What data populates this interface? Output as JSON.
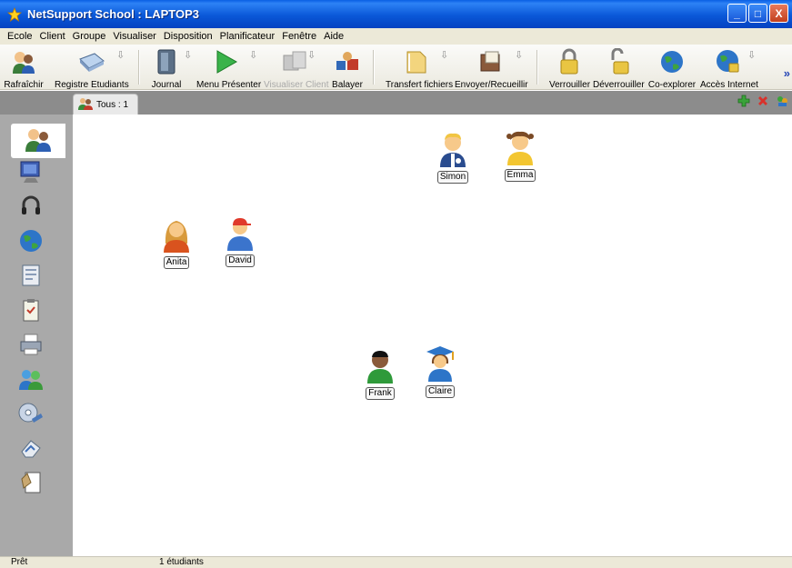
{
  "window": {
    "title": "NetSupport School : LAPTOP3",
    "min_label": "_",
    "max_label": "□",
    "close_label": "X"
  },
  "menu": [
    "Ecole",
    "Client",
    "Groupe",
    "Visualiser",
    "Disposition",
    "Planificateur",
    "Fenêtre",
    "Aide"
  ],
  "toolbar": {
    "refresh": "Rafraîchir",
    "register": "Registre Etudiants",
    "journal": "Journal",
    "present": "Menu Présenter",
    "view": "Visualiser Client",
    "scan": "Balayer",
    "transfer": "Transfert fichiers",
    "collect": "Envoyer/Recueillir",
    "lock": "Verrouiller",
    "unlock": "Déverrouiller",
    "coexplore": "Co-explorer",
    "internet": "Accès Internet",
    "more": "»",
    "drop_arrow": "⇩"
  },
  "tab": {
    "label": "Tous : 1"
  },
  "students": [
    {
      "name": "Simon"
    },
    {
      "name": "Emma"
    },
    {
      "name": "Anita"
    },
    {
      "name": "David"
    },
    {
      "name": "Frank"
    },
    {
      "name": "Claire"
    }
  ],
  "status": {
    "left": "Prêt",
    "count": "1 étudiants"
  },
  "icons": {
    "app": "star-icon",
    "add": "plus-icon",
    "remove": "x-icon",
    "group": "group-icon"
  },
  "colors": {
    "titlebar": "#0a58d8",
    "sidebar": "#a9a9a9",
    "tabbar": "#8c8c8c",
    "chrome": "#ece9d8"
  }
}
